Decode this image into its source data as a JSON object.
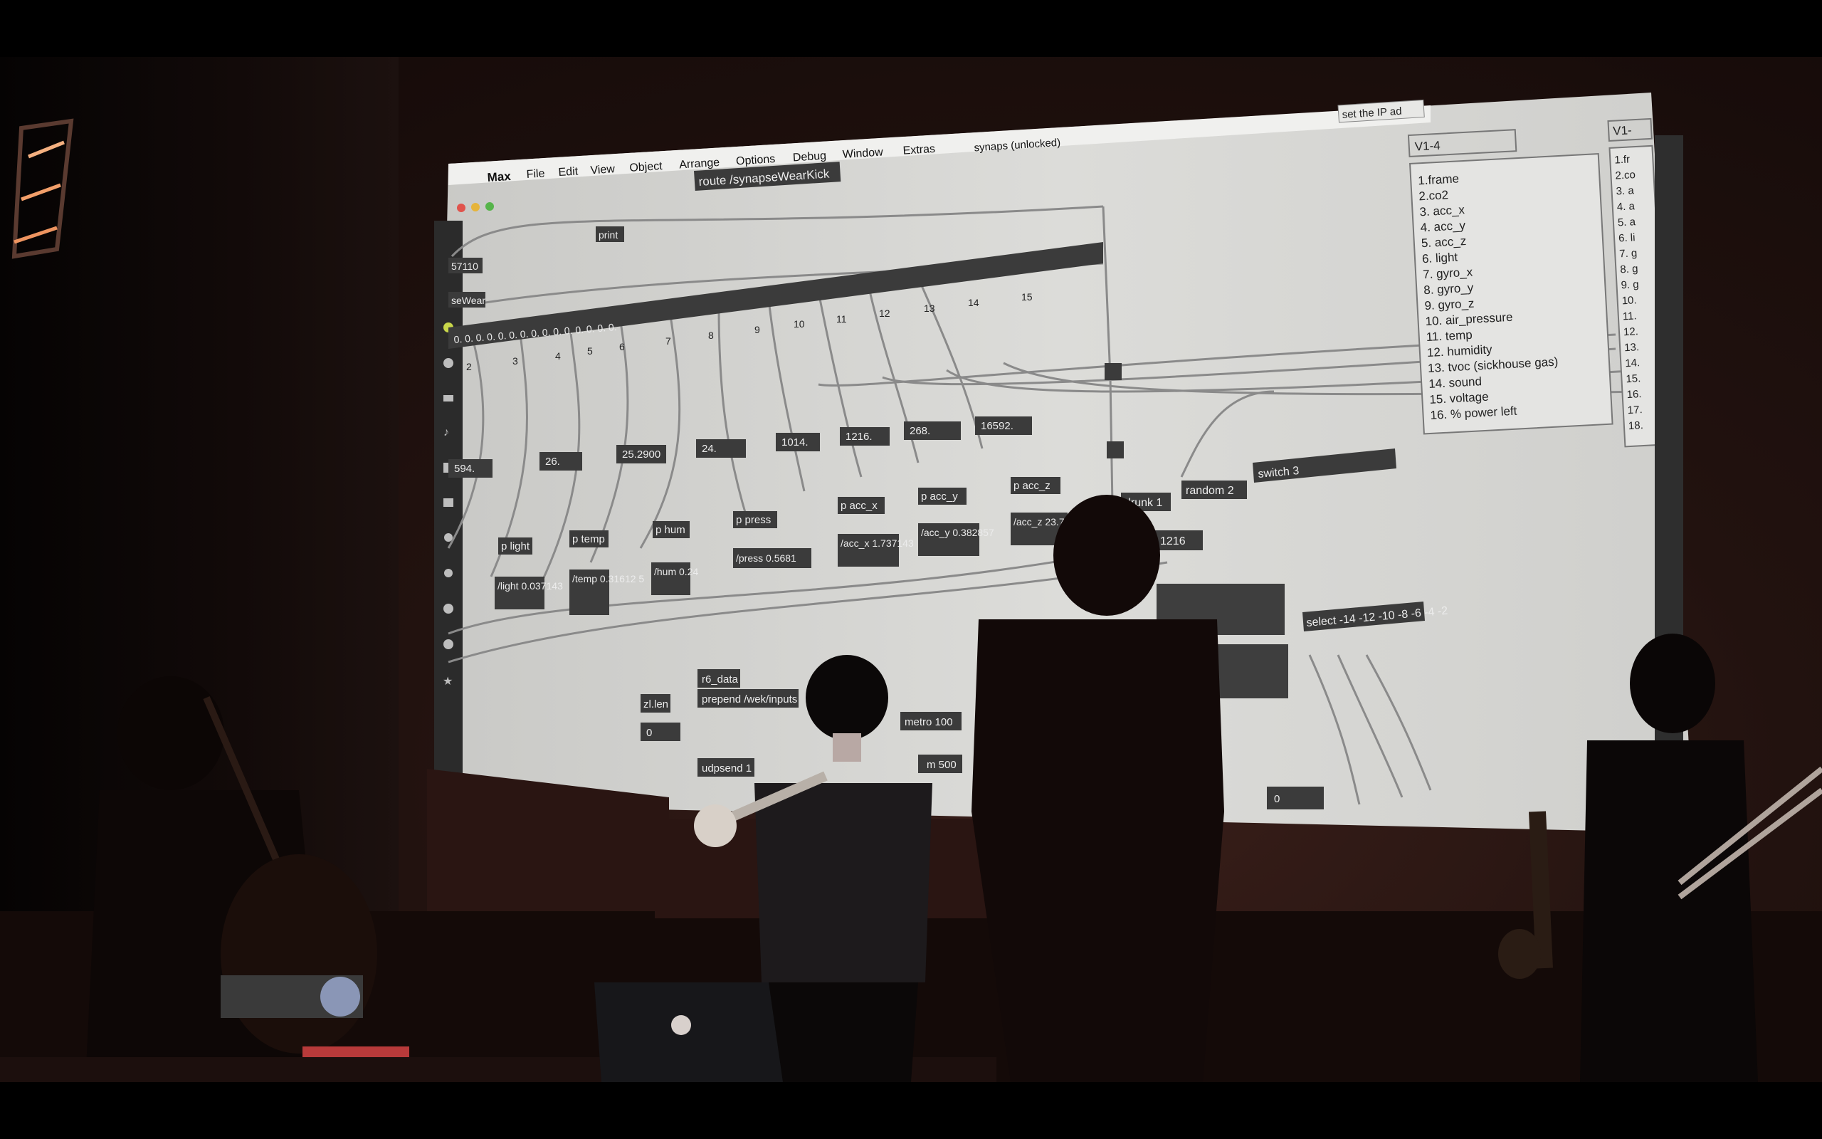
{
  "menubar": {
    "app": "Max",
    "items": [
      "File",
      "Edit",
      "View",
      "Object",
      "Arrange",
      "Options",
      "Debug",
      "Window",
      "Extras"
    ],
    "window_title": "synaps (unlocked)"
  },
  "patch": {
    "print": "print",
    "route": "route /synapseWearKick",
    "left_num": "57110",
    "left_label": "seWear",
    "list_msg": "0. 0. 0. 0. 0. 0. 0. 0. 0. 0. 0. 0. 0. 0. 0.",
    "outlets": [
      "2",
      "3",
      "4",
      "5",
      "6",
      "7",
      "8",
      "9",
      "10",
      "11",
      "12",
      "13",
      "14",
      "15"
    ],
    "numbers": [
      "594.",
      "26.",
      "25.2900",
      "24.",
      "1014.",
      "1216.",
      "268.",
      "16592."
    ],
    "subpatches": [
      "p light",
      "p temp",
      "p hum",
      "p press",
      "p acc_x",
      "p acc_y",
      "p acc_z"
    ],
    "msg_light": "/light 0.037143",
    "msg_temp": "/temp 0.31612 5",
    "msg_hum": "/hum 0.24",
    "msg_press": "/press 0.5681",
    "msg_accx": "/acc_x 1.737143",
    "msg_accy": "/acc_y 0.382857",
    "msg_accz": "/acc_z 23.702",
    "switch": "switch 3",
    "drunk": "drunk 1",
    "random": "random 2",
    "num_1216": "1216",
    "select": "select -14 -12 -10 -8 -6 -4 -2",
    "r6": "r6_data",
    "zlen": "zl.len",
    "zero": "0",
    "prepend": "prepend /wek/inputs",
    "metro": "metro 100",
    "udpsend": "udpsend 1",
    "m500": "m 500",
    "zero2": "0",
    "comment_top": "set the IP ad"
  },
  "legend": {
    "title": "V1-4",
    "items": [
      "1.frame",
      "2.co2",
      "3. acc_x",
      "4. acc_y",
      "5. acc_z",
      "6. light",
      "7. gyro_x",
      "8. gyro_y",
      "9. gyro_z",
      "10. air_pressure",
      "11. temp",
      "12. humidity",
      "13. tvoc (sickhouse gas)",
      "14. sound",
      "15. voltage",
      "16. % power left"
    ]
  },
  "legend2": {
    "title": "V1-",
    "items": [
      "1.fr",
      "2.co",
      "3. a",
      "4. a",
      "5. a",
      "6. li",
      "7. g",
      "8. g",
      "9. g",
      "10.",
      "11.",
      "12.",
      "13.",
      "14.",
      "15.",
      "16.",
      "17.",
      "18."
    ]
  },
  "colors": {
    "screen": "#d9d9d6",
    "box": "#3b3b3b",
    "ink": "#ececec",
    "wall": "#22120f"
  }
}
